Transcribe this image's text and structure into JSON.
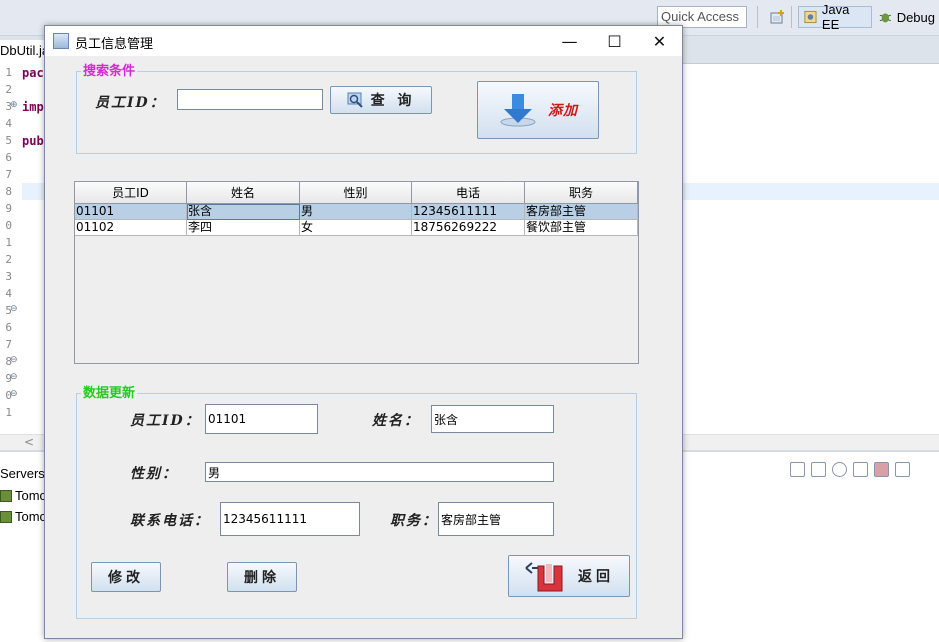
{
  "ide": {
    "quick_access": "Quick Access",
    "perspectives": [
      "Java EE",
      "Debug"
    ],
    "editor_tab": "DbUtil.ja",
    "line_numbers": [
      "1",
      "2",
      "3",
      "4",
      "5",
      "6",
      "7",
      "8",
      "9",
      "0",
      "1",
      "2",
      "3",
      "4",
      "5",
      "6",
      "7",
      "8",
      "9",
      "0",
      "1"
    ],
    "code_lines": [
      "pac",
      "imp",
      "pub"
    ],
    "servers_tab": "Servers",
    "servers": [
      "Tomc",
      "Tomc"
    ]
  },
  "dialog": {
    "title": "员工信息管理",
    "controls": {
      "minimize": "—",
      "maximize": "☐",
      "close": "✕"
    },
    "search": {
      "legend": "搜索条件",
      "legend_color": "#d42ad4",
      "employee_id_label": "员工ID：",
      "employee_id_value": "",
      "query_button": "查 询",
      "add_button": "添加",
      "add_color": "#cc1a1a"
    },
    "table": {
      "columns": [
        "员工ID",
        "姓名",
        "性别",
        "电话",
        "职务"
      ],
      "rows": [
        [
          "01101",
          "张含",
          "男",
          "12345611111",
          "客房部主管"
        ],
        [
          "01102",
          "李四",
          "女",
          "18756269222",
          "餐饮部主管"
        ]
      ],
      "selected_row": 0
    },
    "update": {
      "legend": "数据更新",
      "legend_color": "#22cc22",
      "employee_id_label": "员工ID：",
      "employee_id_value": "01101",
      "name_label": "姓名：",
      "name_value": "张含",
      "gender_label": "性别：",
      "gender_value": "男",
      "phone_label": "联系电话：",
      "phone_value": "12345611111",
      "position_label": "职务：",
      "position_value": "客房部主管",
      "modify_button": "修改",
      "delete_button": "删除",
      "back_button": "返回"
    }
  }
}
